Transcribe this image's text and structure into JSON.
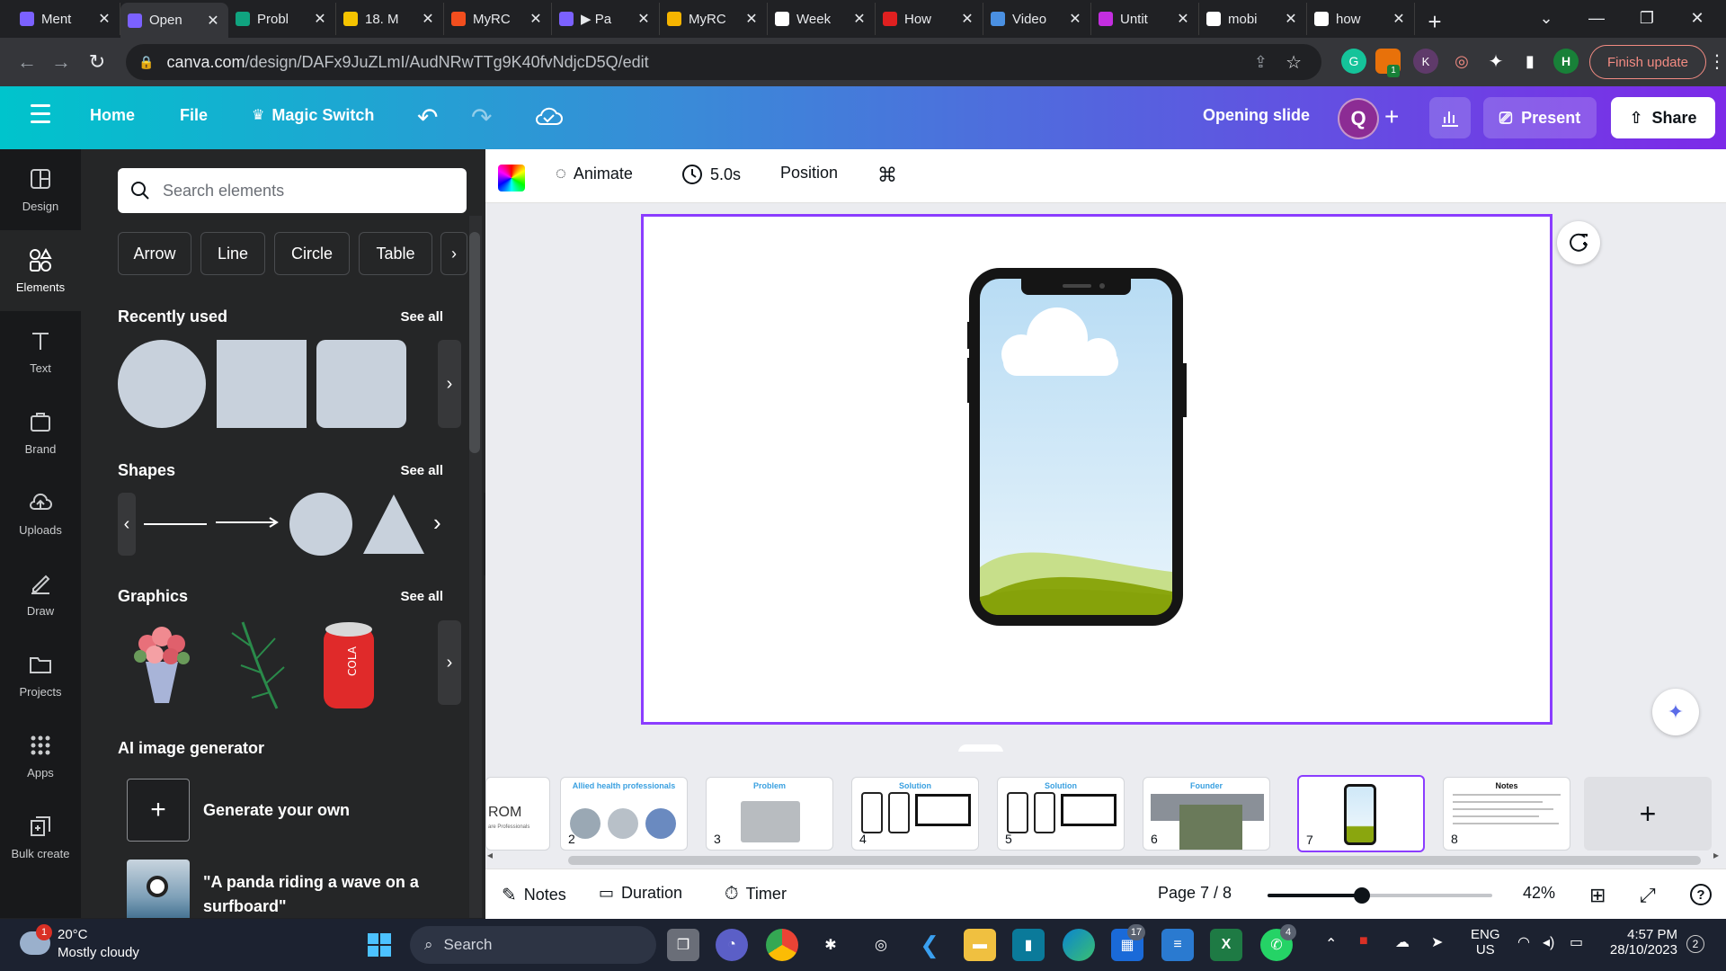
{
  "browser": {
    "tabs": [
      {
        "title": "Ment",
        "color": "#7b61ff"
      },
      {
        "title": "Open",
        "color": "#7b61ff",
        "active": true
      },
      {
        "title": "Probl",
        "color": "#10a37f"
      },
      {
        "title": "18. M",
        "color": "#f5c400"
      },
      {
        "title": "MyRC",
        "color": "#f24e1e"
      },
      {
        "title": "▶ Pa",
        "color": "#7b61ff"
      },
      {
        "title": "MyRC",
        "color": "#f5b400"
      },
      {
        "title": "Week",
        "color": "#ffffff"
      },
      {
        "title": "How",
        "color": "#e02020"
      },
      {
        "title": "Video",
        "color": "#4a90e2"
      },
      {
        "title": "Untit",
        "color": "#c42ee0"
      },
      {
        "title": "mobi",
        "color": "#ffffff"
      },
      {
        "title": "how",
        "color": "#ffffff"
      }
    ],
    "url_host": "canva.com",
    "url_path": "/design/DAFx9JuZLmI/AudNRwTTg9K40fvNdjcD5Q/edit",
    "finish_update": "Finish update",
    "profile_initial": "H",
    "ext_k": "K",
    "ext_badge": "1"
  },
  "header": {
    "home": "Home",
    "file": "File",
    "magic_switch": "Magic Switch",
    "title": "Opening slide",
    "avatar": "Q",
    "present": "Present",
    "share": "Share"
  },
  "rail": [
    {
      "label": "Design",
      "icon": "design-icon"
    },
    {
      "label": "Elements",
      "icon": "elements-icon",
      "active": true
    },
    {
      "label": "Text",
      "icon": "text-icon"
    },
    {
      "label": "Brand",
      "icon": "brand-icon"
    },
    {
      "label": "Uploads",
      "icon": "uploads-icon"
    },
    {
      "label": "Draw",
      "icon": "draw-icon"
    },
    {
      "label": "Projects",
      "icon": "projects-icon"
    },
    {
      "label": "Apps",
      "icon": "apps-icon"
    },
    {
      "label": "Bulk create",
      "icon": "bulk-create-icon"
    }
  ],
  "panel": {
    "search_placeholder": "Search elements",
    "chips": [
      "Arrow",
      "Line",
      "Circle",
      "Table"
    ],
    "recently_used": "Recently used",
    "shapes": "Shapes",
    "graphics": "Graphics",
    "see_all": "See all",
    "ai_title": "AI image generator",
    "generate": "Generate your own",
    "panda_line1": "\"A panda riding a wave on a",
    "panda_line2": "surfboard\""
  },
  "toolbar": {
    "animate": "Animate",
    "duration": "5.0s",
    "position": "Position"
  },
  "filmstrip": {
    "pages": [
      {
        "num": "",
        "title": "ROM",
        "subtitle": "are Professionals"
      },
      {
        "num": "2",
        "title": "Allied health professionals"
      },
      {
        "num": "3",
        "title": "Problem"
      },
      {
        "num": "4",
        "title": "Solution"
      },
      {
        "num": "5",
        "title": "Solution"
      },
      {
        "num": "6",
        "title": "Founder"
      },
      {
        "num": "7",
        "title": "",
        "active": true
      },
      {
        "num": "8",
        "title": "Notes"
      }
    ]
  },
  "footer": {
    "notes": "Notes",
    "duration": "Duration",
    "timer": "Timer",
    "page": "Page 7 / 8",
    "zoom": "42%",
    "zoom_level": 0.42
  },
  "taskbar": {
    "temp": "20°C",
    "weather": "Mostly cloudy",
    "weather_badge": "1",
    "search": "Search",
    "lang1": "ENG",
    "lang2": "US",
    "time": "4:57 PM",
    "date": "28/10/2023",
    "notif": "2",
    "badge_outlook": "17",
    "badge_whatsapp": "4"
  }
}
